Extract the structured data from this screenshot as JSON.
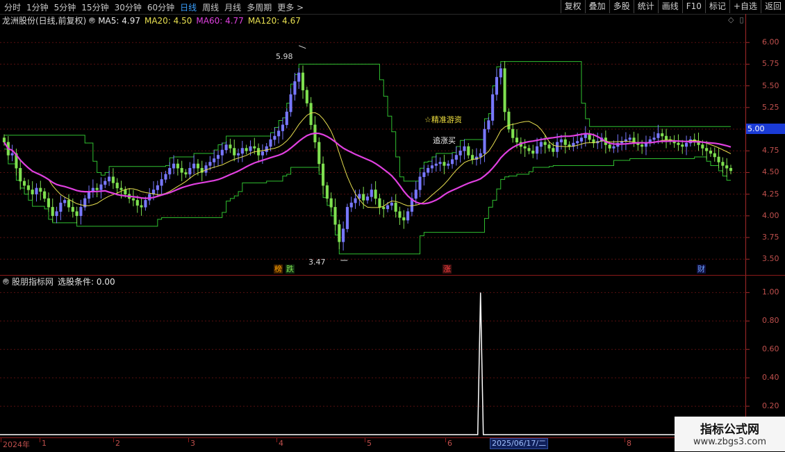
{
  "toolbar": {
    "periods": [
      "分时",
      "1分钟",
      "5分钟",
      "15分钟",
      "30分钟",
      "60分钟",
      "日线",
      "周线",
      "月线",
      "多周期",
      "更多 >"
    ],
    "active_period": "日线",
    "buttons": [
      "复权",
      "叠加",
      "多股",
      "统计",
      "画线",
      "F10",
      "标记",
      "+自选",
      "返回"
    ]
  },
  "main_header": {
    "title": "龙洲股份(日线,前复权)",
    "ma": [
      {
        "label": "MA5: 4.97",
        "color": "#e8e8e8"
      },
      {
        "label": "MA20: 4.50",
        "color": "#e8e050"
      },
      {
        "label": "MA60: 4.77",
        "color": "#e040e0"
      },
      {
        "label": "MA120: 4.67",
        "color": "#e8e050"
      }
    ]
  },
  "sub_header": {
    "title": "股朋指标网",
    "condition": "选股条件: 0.00"
  },
  "colors": {
    "up": "#ff3b3b",
    "up_body": "#000000",
    "down": "#7fe050",
    "candle_blue": "#7878ff",
    "ma5": "#e8e8e8",
    "ma20": "#e8e050",
    "ma60": "#e040e0",
    "channel": "#30c030",
    "signal": "#ffffff"
  },
  "current_price": "5.00",
  "selected_date": "2025/06/17/二",
  "event_markers": [
    {
      "text": "榜",
      "color": "#ffa500",
      "bg": "#402000"
    },
    {
      "text": "跌",
      "color": "#7fe050",
      "bg": "#103010"
    },
    {
      "text": "涨",
      "color": "#ff4040",
      "bg": "#401010"
    },
    {
      "text": "财",
      "color": "#6aa0ff",
      "bg": "#101040"
    }
  ],
  "annotations": {
    "high": "5.98",
    "low": "3.47",
    "text1": "☆精准游资",
    "text2": "追涨买"
  },
  "watermark": {
    "line1": "指标公式网",
    "line2": "www.zbgs3.com"
  },
  "chart_data": [
    {
      "type": "candlestick",
      "title": "龙洲股份(日线,前复权)",
      "ylim": [
        3.35,
        6.25
      ],
      "yticks": [
        3.5,
        3.75,
        4.0,
        4.25,
        4.5,
        4.75,
        5.0,
        5.25,
        5.5,
        5.75,
        6.0
      ],
      "xticks": [
        "2024年",
        "1",
        "2",
        "3",
        "4",
        "5",
        "6",
        "2025/06/17/二",
        "8"
      ],
      "high_label": 5.98,
      "low_label": 3.47,
      "close": [
        4.85,
        4.7,
        4.72,
        4.55,
        4.4,
        4.35,
        4.3,
        4.25,
        4.32,
        4.28,
        4.2,
        4.1,
        4.0,
        4.05,
        4.15,
        4.18,
        4.1,
        4.05,
        4.0,
        4.1,
        4.2,
        4.28,
        4.32,
        4.3,
        4.36,
        4.4,
        4.45,
        4.38,
        4.32,
        4.3,
        4.25,
        4.2,
        4.18,
        4.12,
        4.1,
        4.18,
        4.25,
        4.3,
        4.35,
        4.42,
        4.48,
        4.55,
        4.6,
        4.55,
        4.5,
        4.48,
        4.55,
        4.6,
        4.55,
        4.5,
        4.58,
        4.62,
        4.66,
        4.7,
        4.76,
        4.82,
        4.78,
        4.7,
        4.72,
        4.78,
        4.75,
        4.8,
        4.78,
        4.7,
        4.74,
        4.8,
        4.88,
        4.92,
        4.98,
        5.05,
        5.2,
        5.4,
        5.55,
        5.65,
        5.45,
        5.3,
        5.05,
        4.85,
        4.6,
        4.35,
        4.2,
        4.1,
        3.9,
        3.7,
        3.85,
        4.1,
        4.15,
        4.2,
        4.25,
        4.18,
        4.22,
        4.3,
        4.2,
        4.1,
        4.08,
        4.12,
        4.15,
        4.05,
        3.98,
        3.95,
        4.05,
        4.2,
        4.3,
        4.45,
        4.5,
        4.55,
        4.58,
        4.6,
        4.62,
        4.58,
        4.6,
        4.65,
        4.7,
        4.75,
        4.8,
        4.7,
        4.65,
        4.68,
        4.72,
        5.0,
        5.1,
        5.4,
        5.6,
        5.7,
        5.2,
        5.0,
        4.9,
        4.85,
        4.8,
        4.78,
        4.75,
        4.72,
        4.8,
        4.85,
        4.82,
        4.78,
        4.74,
        4.85,
        4.88,
        4.82,
        4.8,
        4.84,
        4.86,
        4.9,
        4.95,
        4.88,
        4.84,
        4.86,
        4.9,
        4.82,
        4.78,
        4.8,
        4.84,
        4.86,
        4.88,
        4.9,
        4.85,
        4.82,
        4.8,
        4.84,
        4.88,
        4.9,
        4.95,
        4.92,
        4.88,
        4.86,
        4.84,
        4.82,
        4.8,
        4.84,
        4.88,
        4.86,
        4.82,
        4.78,
        4.75,
        4.72,
        4.68,
        4.62,
        4.58,
        4.55,
        4.52
      ],
      "channel_upper": 6.05,
      "ma5_last": 4.97,
      "ma20_last": 4.5,
      "ma60_last": 4.77,
      "ma120_last": 4.67
    },
    {
      "type": "line",
      "title": "股朋指标网",
      "series_label": "选股条件: 0.00",
      "ylim": [
        0.1,
        1.08
      ],
      "yticks": [
        0.2,
        0.4,
        0.6,
        0.8,
        1.0
      ],
      "spike_at_index": 118,
      "spike_value": 1.0,
      "baseline": 0.0
    }
  ]
}
